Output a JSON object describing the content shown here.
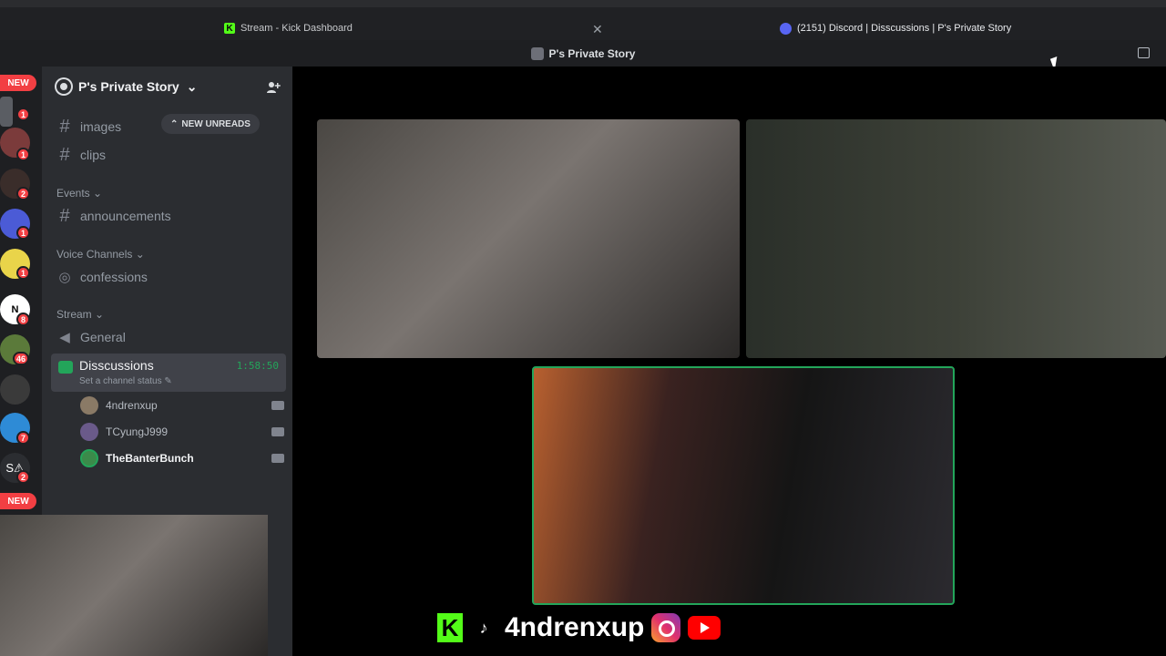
{
  "browser": {
    "tabs": [
      {
        "label": "Stream - Kick Dashboard",
        "icon": "kick-icon"
      },
      {
        "label": "(2151) Discord | Disscussions | P's Private Story",
        "icon": "discord-icon"
      }
    ]
  },
  "window": {
    "title": "P's Private Story"
  },
  "server_rail": {
    "new_label": "NEW",
    "badges": [
      "1",
      "1",
      "2",
      "1",
      "1",
      "8",
      "46",
      "7",
      "2"
    ],
    "server_letters": [
      "N",
      "S⚠"
    ]
  },
  "sidebar": {
    "guild_name": "P's Private Story",
    "new_unreads": "NEW UNREADS",
    "channels": {
      "images": "images",
      "clips": "clips",
      "announcements": "announcements",
      "confessions": "confessions",
      "general": "General"
    },
    "categories": {
      "events": "Events",
      "voice": "Voice Channels",
      "stream": "Stream"
    },
    "active_voice": {
      "name": "Disscussions",
      "status": "Set a channel status",
      "duration": "1:58:50"
    },
    "voice_users": [
      {
        "name": "4ndrenxup"
      },
      {
        "name": "TCyungJ999"
      },
      {
        "name": "TheBanterBunch"
      }
    ]
  },
  "overlay": {
    "handle": "4ndrenxup"
  },
  "colors": {
    "accent_green": "#23a55a",
    "kick_green": "#53fc18",
    "badge_red": "#f23f43"
  }
}
